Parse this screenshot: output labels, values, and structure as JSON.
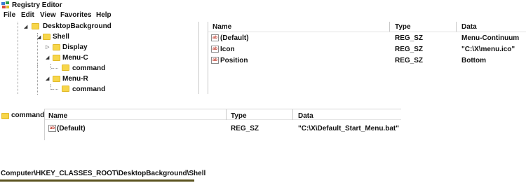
{
  "title": "Registry Editor",
  "menu": [
    "File",
    "Edit",
    "View",
    "Favorites",
    "Help"
  ],
  "tree": {
    "desktop_background": "DesktopBackground",
    "shell": "Shell",
    "display": "Display",
    "menu_c": "Menu-C",
    "command_c": "command",
    "menu_r": "Menu-R",
    "command_r": "command"
  },
  "top_pane": {
    "headers": {
      "name": "Name",
      "type": "Type",
      "data": "Data"
    },
    "rows": [
      {
        "name": "(Default)",
        "type": "REG_SZ",
        "data": "Menu-Continuum"
      },
      {
        "name": "Icon",
        "type": "REG_SZ",
        "data": "\"C:\\X\\menu.ico\""
      },
      {
        "name": "Position",
        "type": "REG_SZ",
        "data": "Bottom"
      }
    ]
  },
  "bottom": {
    "tree_item": "command",
    "headers": {
      "name": "Name",
      "type": "Type",
      "data": "Data"
    },
    "rows": [
      {
        "name": "(Default)",
        "type": "REG_SZ",
        "data": "\"C:\\X\\Default_Start_Menu.bat\""
      }
    ]
  },
  "status_path": "Computer\\HKEY_CLASSES_ROOT\\DesktopBackground\\Shell",
  "icons": {
    "app": "registry-editor-icon",
    "key": "folder-icon",
    "value": "string-value-icon",
    "value_glyph": "ab"
  },
  "colors": {
    "folder": "#f7d64a",
    "status_underline": "#5b5320"
  }
}
